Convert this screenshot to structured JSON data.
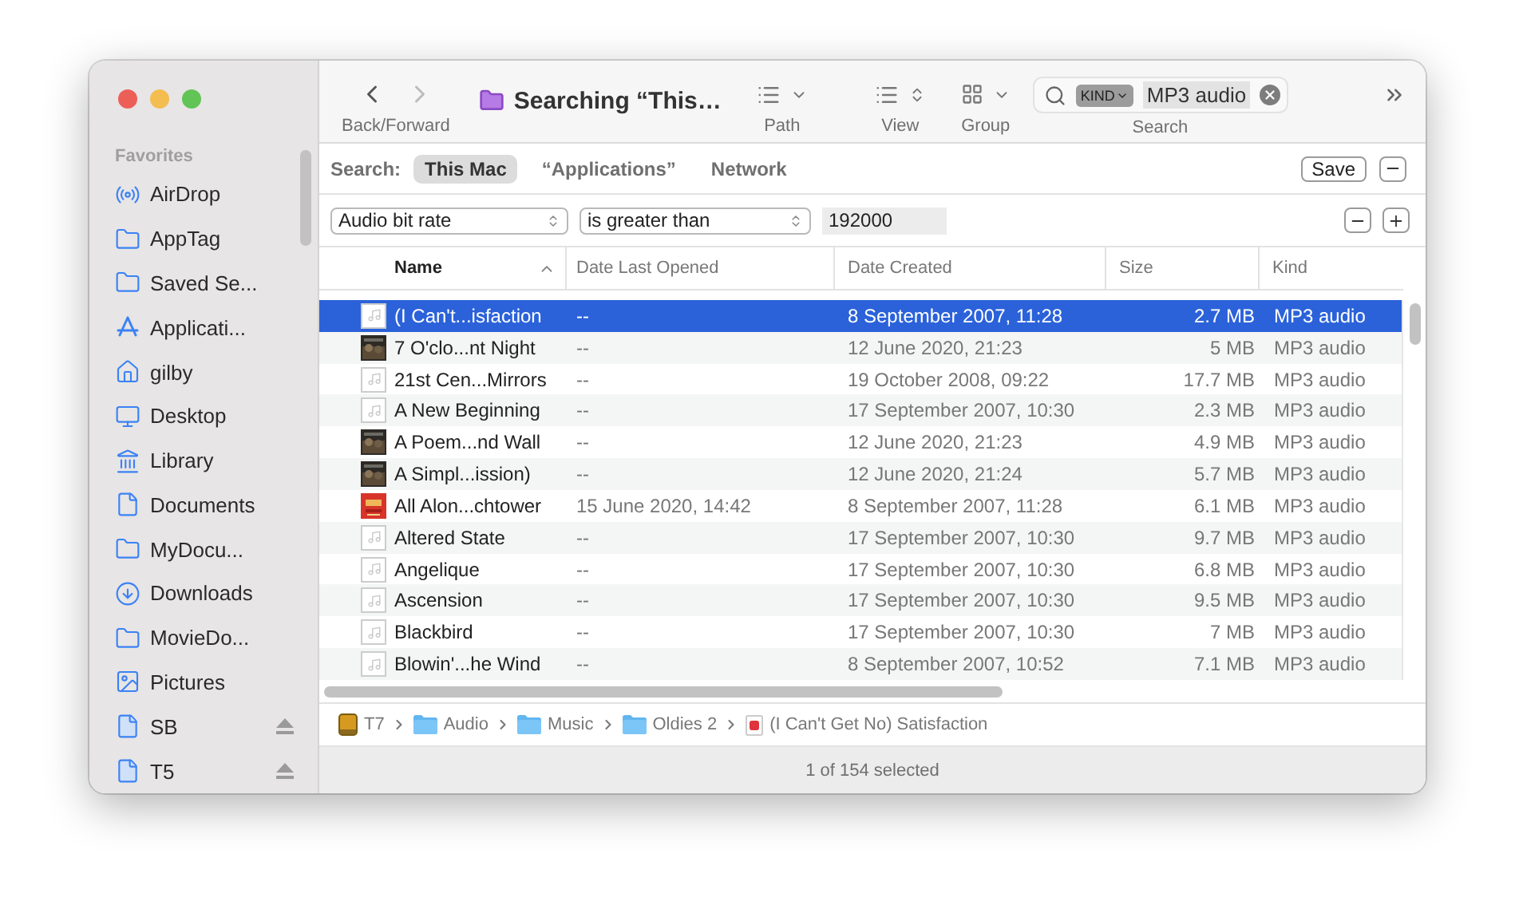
{
  "window": {
    "title": "Searching “This…"
  },
  "toolbar": {
    "nav_label": "Back/Forward",
    "path_label": "Path",
    "view_label": "View",
    "group_label": "Group",
    "search_label": "Search",
    "search_token": "KIND",
    "search_value": "MP3 audio"
  },
  "sidebar": {
    "heading": "Favorites",
    "items": [
      {
        "label": "AirDrop",
        "kind": "airdrop",
        "ejectable": false
      },
      {
        "label": "AppTag",
        "kind": "folder",
        "ejectable": false
      },
      {
        "label": "Saved Se...",
        "kind": "folder",
        "ejectable": false
      },
      {
        "label": "Applicati...",
        "kind": "apps",
        "ejectable": false
      },
      {
        "label": "gilby",
        "kind": "home",
        "ejectable": false
      },
      {
        "label": "Desktop",
        "kind": "desktop",
        "ejectable": false
      },
      {
        "label": "Library",
        "kind": "library",
        "ejectable": false
      },
      {
        "label": "Documents",
        "kind": "document",
        "ejectable": false
      },
      {
        "label": "MyDocu...",
        "kind": "folder",
        "ejectable": false
      },
      {
        "label": "Downloads",
        "kind": "download",
        "ejectable": false
      },
      {
        "label": "MovieDo...",
        "kind": "folder",
        "ejectable": false
      },
      {
        "label": "Pictures",
        "kind": "pictures",
        "ejectable": false
      },
      {
        "label": "SB",
        "kind": "disk",
        "ejectable": true
      },
      {
        "label": "T5",
        "kind": "disk",
        "ejectable": true
      }
    ]
  },
  "scope": {
    "label": "Search:",
    "options": [
      {
        "label": "This Mac",
        "selected": true
      },
      {
        "label": "“Applications”",
        "selected": false
      },
      {
        "label": "Network",
        "selected": false
      }
    ],
    "save": "Save"
  },
  "criteria": {
    "attribute": "Audio bit rate",
    "operator": "is greater than",
    "value": "192000"
  },
  "table": {
    "columns": [
      {
        "label": "Name",
        "sorted": true
      },
      {
        "label": "Date Last Opened",
        "sorted": false
      },
      {
        "label": "Date Created",
        "sorted": false
      },
      {
        "label": "Size",
        "sorted": false
      },
      {
        "label": "Kind",
        "sorted": false
      }
    ],
    "rows": [
      {
        "name": "(I Can't...isfaction",
        "kind": "blank",
        "opened": "--",
        "created": "8 September 2007, 11:28",
        "size": "2.7 MB",
        "file_kind": "MP3 audio",
        "selected": true
      },
      {
        "name": "7 O'clo...nt Night",
        "kind": "dark",
        "opened": "--",
        "created": "12 June 2020, 21:23",
        "size": "5 MB",
        "file_kind": "MP3 audio",
        "selected": false
      },
      {
        "name": "21st Cen...Mirrors",
        "kind": "blank",
        "opened": "--",
        "created": "19 October 2008, 09:22",
        "size": "17.7 MB",
        "file_kind": "MP3 audio",
        "selected": false
      },
      {
        "name": "A New Beginning",
        "kind": "blank",
        "opened": "--",
        "created": "17 September 2007, 10:30",
        "size": "2.3 MB",
        "file_kind": "MP3 audio",
        "selected": false
      },
      {
        "name": "A Poem...nd Wall",
        "kind": "dark",
        "opened": "--",
        "created": "12 June 2020, 21:23",
        "size": "4.9 MB",
        "file_kind": "MP3 audio",
        "selected": false
      },
      {
        "name": "A Simpl...ission)",
        "kind": "dark",
        "opened": "--",
        "created": "12 June 2020, 21:24",
        "size": "5.7 MB",
        "file_kind": "MP3 audio",
        "selected": false
      },
      {
        "name": "All Alon...chtower",
        "kind": "red",
        "opened": "15 June 2020, 14:42",
        "created": "8 September 2007, 11:28",
        "size": "6.1 MB",
        "file_kind": "MP3 audio",
        "selected": false
      },
      {
        "name": "Altered State",
        "kind": "blank",
        "opened": "--",
        "created": "17 September 2007, 10:30",
        "size": "9.7 MB",
        "file_kind": "MP3 audio",
        "selected": false
      },
      {
        "name": "Angelique",
        "kind": "blank",
        "opened": "--",
        "created": "17 September 2007, 10:30",
        "size": "6.8 MB",
        "file_kind": "MP3 audio",
        "selected": false
      },
      {
        "name": "Ascension",
        "kind": "blank",
        "opened": "--",
        "created": "17 September 2007, 10:30",
        "size": "9.5 MB",
        "file_kind": "MP3 audio",
        "selected": false
      },
      {
        "name": "Blackbird",
        "kind": "blank",
        "opened": "--",
        "created": "17 September 2007, 10:30",
        "size": "7 MB",
        "file_kind": "MP3 audio",
        "selected": false
      },
      {
        "name": "Blowin'...he Wind",
        "kind": "blank",
        "opened": "--",
        "created": "8 September 2007, 10:52",
        "size": "7.1 MB",
        "file_kind": "MP3 audio",
        "selected": false
      }
    ]
  },
  "path_bar": [
    {
      "label": "T7",
      "kind": "disk"
    },
    {
      "label": "Audio",
      "kind": "folder"
    },
    {
      "label": "Music",
      "kind": "folder"
    },
    {
      "label": "Oldies 2",
      "kind": "folder"
    },
    {
      "label": "(I Can't Get No) Satisfaction",
      "kind": "audio"
    }
  ],
  "status": "1 of 154 selected"
}
